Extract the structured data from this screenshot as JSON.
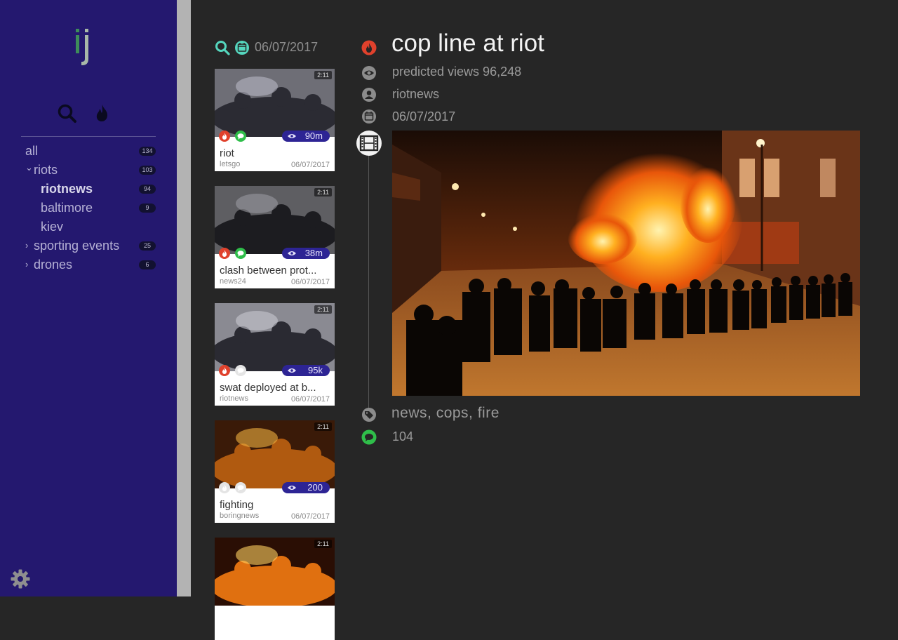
{
  "app": {
    "logo_text": "ij"
  },
  "sidebar": {
    "tools": [
      {
        "icon": "search-icon"
      },
      {
        "icon": "flame-icon"
      }
    ],
    "tree": [
      {
        "label": "all",
        "count": "134",
        "level": 0,
        "chevron": ""
      },
      {
        "label": "riots",
        "count": "103",
        "level": 0,
        "chevron": "⌄"
      },
      {
        "label": "riotnews",
        "count": "94",
        "level": 1,
        "chevron": "",
        "active": true
      },
      {
        "label": "baltimore",
        "count": "9",
        "level": 1,
        "chevron": ""
      },
      {
        "label": "kiev",
        "count": "",
        "level": 1,
        "chevron": ""
      },
      {
        "label": "sporting events",
        "count": "25",
        "level": 0,
        "chevron": "›"
      },
      {
        "label": "drones",
        "count": "6",
        "level": 0,
        "chevron": "›"
      }
    ],
    "settings_icon": "gear-icon"
  },
  "list": {
    "date": "06/07/2017",
    "cards": [
      {
        "title": "riot",
        "source": "letsgo",
        "date": "06/07/2017",
        "views": "90m",
        "duration": "2:11",
        "hot": true,
        "commented": true
      },
      {
        "title": "clash between prot...",
        "source": "news24",
        "date": "06/07/2017",
        "views": "38m",
        "duration": "2:11",
        "hot": true,
        "commented": true
      },
      {
        "title": "swat deployed at b...",
        "source": "riotnews",
        "date": "06/07/2017",
        "views": "95k",
        "duration": "2:11",
        "hot": true,
        "commented": false
      },
      {
        "title": "fighting",
        "source": "boringnews",
        "date": "06/07/2017",
        "views": "200",
        "duration": "2:11",
        "hot": false,
        "commented": false
      },
      {
        "title": "",
        "source": "",
        "date": "",
        "views": "",
        "duration": "2:11",
        "hot": false,
        "commented": false
      }
    ]
  },
  "detail": {
    "title": "cop line at riot",
    "predicted_views": "predicted views 96,248",
    "author": "riotnews",
    "date": "06/07/2017",
    "tags": "news, cops, fire",
    "comments": "104"
  },
  "colors": {
    "sidebar_bg": "#24186f",
    "accent_red": "#e0412c",
    "accent_green": "#2fbe4a",
    "accent_teal": "#55d6be",
    "badge_bg": "#2d2494"
  }
}
